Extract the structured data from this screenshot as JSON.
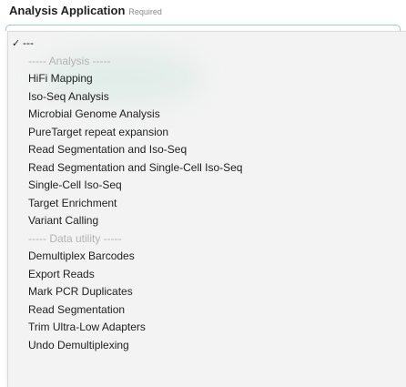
{
  "field": {
    "label": "Analysis Application",
    "required": "Required"
  },
  "dropdown": {
    "selected_value": "---",
    "check_mark": "✓",
    "groups": [
      {
        "header": "----- Analysis -----",
        "items": [
          "HiFi Mapping",
          "Iso-Seq Analysis",
          "Microbial Genome Analysis",
          "PureTarget repeat expansion",
          "Read Segmentation and Iso-Seq",
          "Read Segmentation and Single-Cell Iso-Seq",
          "Single-Cell Iso-Seq",
          "Target Enrichment",
          "Variant Calling"
        ]
      },
      {
        "header": "----- Data utility -----",
        "items": [
          "Demultiplex Barcodes",
          "Export Reads",
          "Mark PCR Duplicates",
          "Read Segmentation",
          "Trim Ultra-Low Adapters",
          "Undo Demultiplexing"
        ]
      }
    ]
  }
}
